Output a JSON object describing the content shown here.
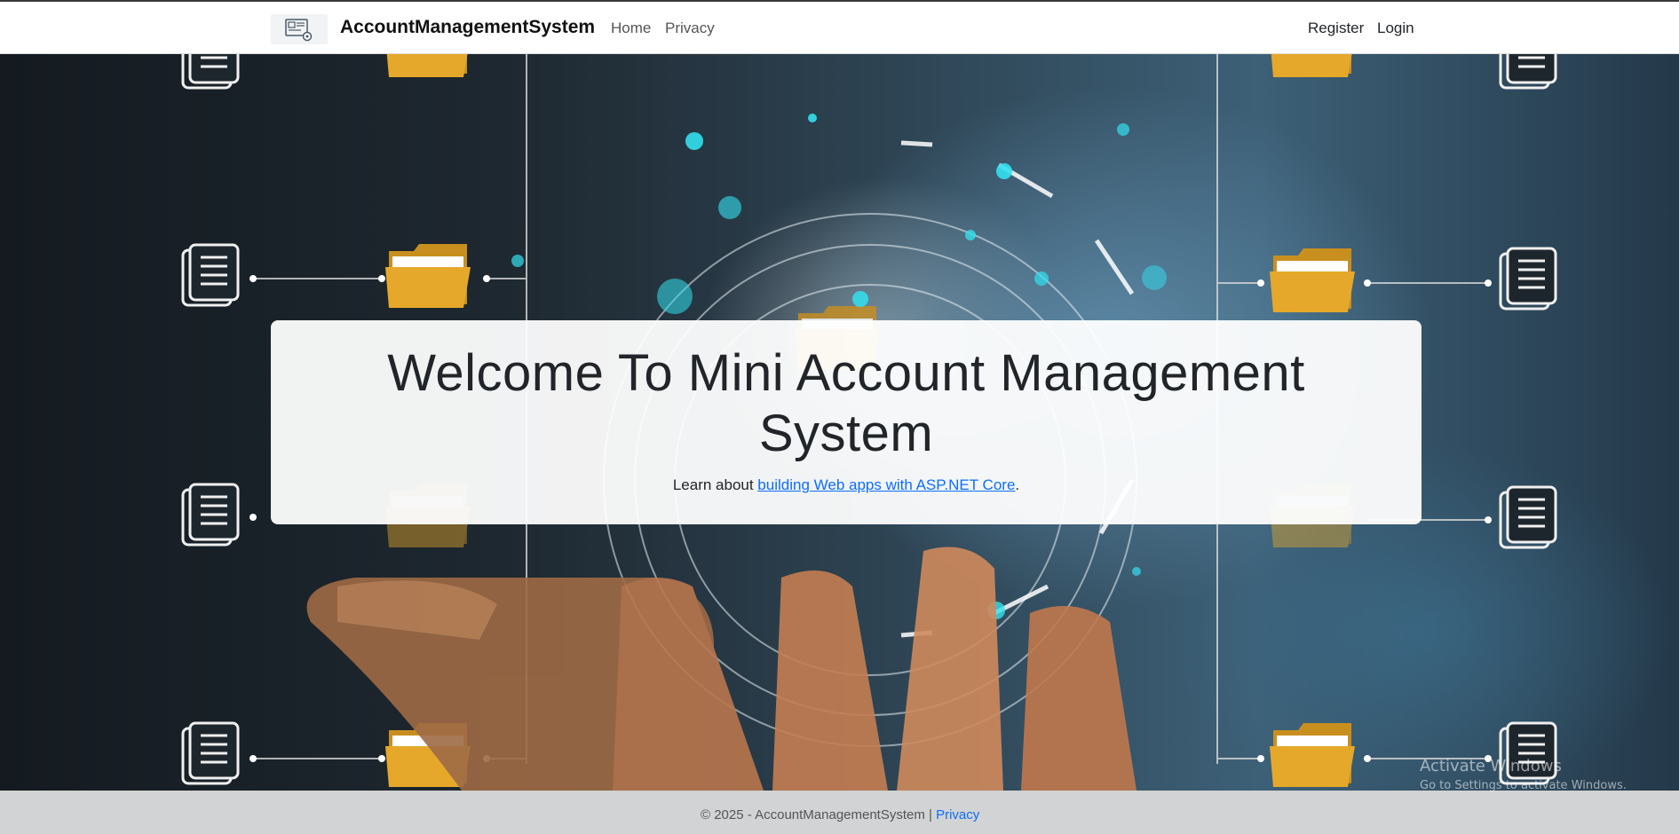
{
  "navbar": {
    "brand": "AccountManagementSystem",
    "links": {
      "home": "Home",
      "privacy": "Privacy",
      "register": "Register",
      "login": "Login"
    }
  },
  "hero": {
    "title": "Welcome To Mini Account Management System",
    "subtitle_prefix": "Learn about ",
    "subtitle_link": "building Web apps with ASP.NET Core",
    "subtitle_suffix": "."
  },
  "footer": {
    "copyright": "© 2025 - AccountManagementSystem | ",
    "privacy_link": "Privacy"
  },
  "watermark": {
    "title": "Activate Windows",
    "subtitle": "Go to Settings to activate Windows."
  },
  "icons": {
    "brand": "account-settings-icon",
    "documents": "document-icon",
    "folders": "folder-icon"
  },
  "colors": {
    "link": "#0d6efd",
    "folder": "#e6a82a",
    "navbar_bg": "#ffffff"
  }
}
